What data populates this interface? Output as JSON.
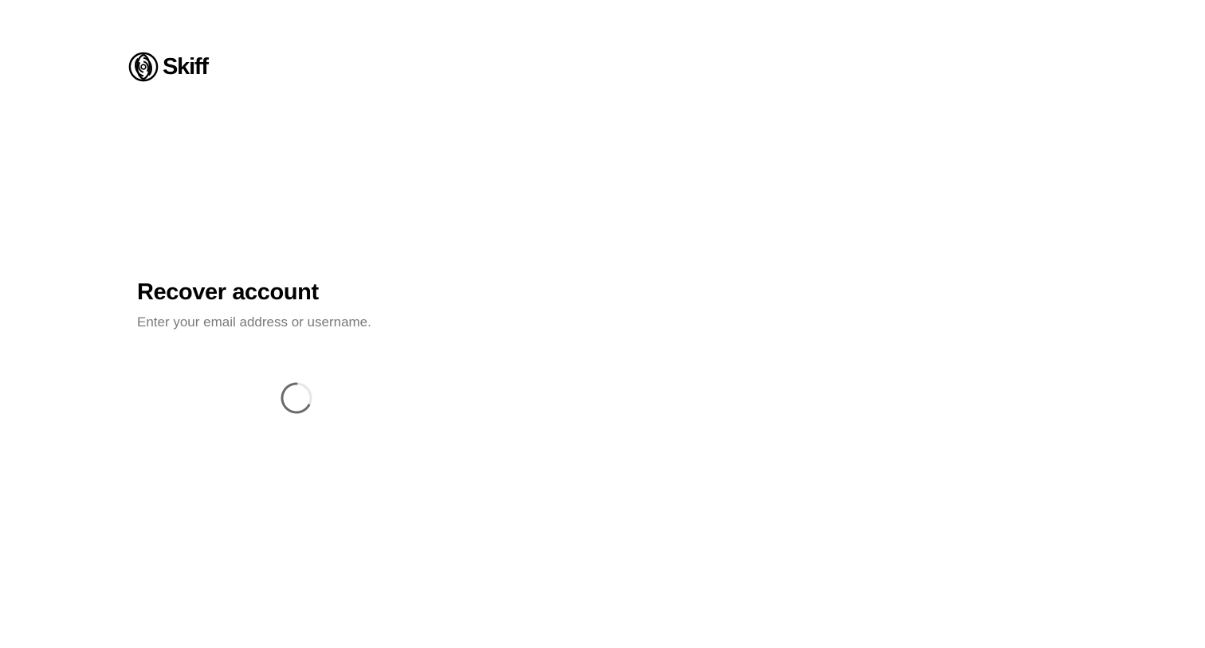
{
  "brand": {
    "name": "Skiff",
    "logo_icon": "skiff-logo-icon",
    "color": "#000000"
  },
  "recover": {
    "title": "Recover account",
    "subtitle": "Enter your email address or username."
  },
  "status": {
    "loading_icon": "loading-spinner-icon",
    "spinner_color": "#6b6b6b",
    "spinner_track_color": "#e6e6e6"
  },
  "colors": {
    "background": "#ffffff",
    "text_primary": "#000000",
    "text_secondary": "#7a7a7a"
  }
}
